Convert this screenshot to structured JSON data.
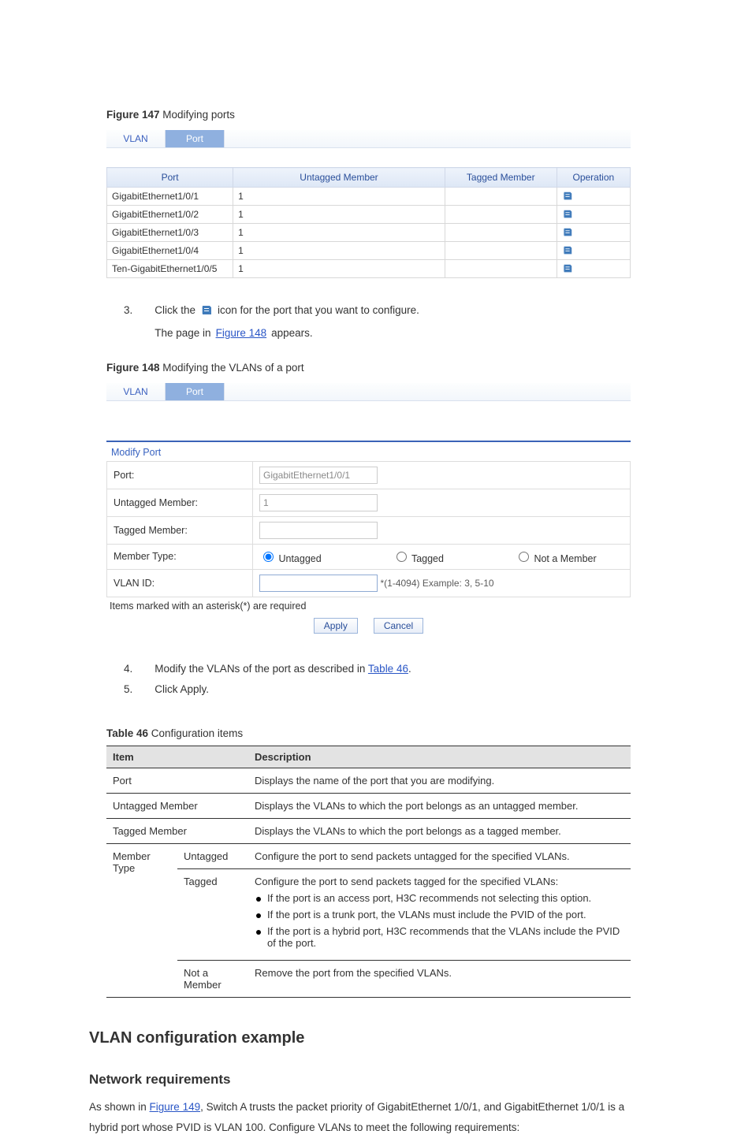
{
  "figure1": {
    "caption_label": "Figure 147",
    "caption_text": "Modifying ports",
    "tabs": {
      "vlan": "VLAN",
      "port": "Port"
    },
    "table": {
      "headers": {
        "port": "Port",
        "untagged": "Untagged Member",
        "tagged": "Tagged Member",
        "operation": "Operation"
      },
      "rows": [
        {
          "port": "GigabitEthernet1/0/1",
          "untagged": "1",
          "tagged": ""
        },
        {
          "port": "GigabitEthernet1/0/2",
          "untagged": "1",
          "tagged": ""
        },
        {
          "port": "GigabitEthernet1/0/3",
          "untagged": "1",
          "tagged": ""
        },
        {
          "port": "GigabitEthernet1/0/4",
          "untagged": "1",
          "tagged": ""
        },
        {
          "port": "Ten-GigabitEthernet1/0/5",
          "untagged": "1",
          "tagged": ""
        }
      ]
    }
  },
  "instruction": {
    "step_num": "3.",
    "text_before_icon": "Click the",
    "text_after_icon": "icon for the port that you want to configure.",
    "link_prefix": "The page in ",
    "link_text": "Figure 148",
    "link_suffix": " appears."
  },
  "figure2": {
    "caption_label": "Figure 148",
    "caption_text": "Modifying the VLANs of a port",
    "tabs": {
      "vlan": "VLAN",
      "port": "Port"
    },
    "panel_title": "Modify Port",
    "fields": {
      "port_label": "Port:",
      "port_value": "GigabitEthernet1/0/1",
      "untagged_label": "Untagged Member:",
      "untagged_value": "1",
      "tagged_label": "Tagged Member:",
      "tagged_value": "",
      "member_type_label": "Member Type:",
      "radio_untagged": "Untagged",
      "radio_tagged": "Tagged",
      "radio_not_member": "Not a Member",
      "vlan_id_label": "VLAN ID:",
      "vlan_id_value": "",
      "vlan_id_hint": "*(1-4094) Example: 3, 5-10"
    },
    "required_note": "Items marked with an asterisk(*) are required",
    "buttons": {
      "apply": "Apply",
      "cancel": "Cancel"
    }
  },
  "step4": {
    "num": "4.",
    "text_before_link": "Modify the VLANs of the port as described in ",
    "link_text": "Table 46",
    "text_after_link": "."
  },
  "step5": {
    "num": "5.",
    "text": "Click Apply."
  },
  "desc": {
    "caption_label": "Table 46",
    "caption_text": "Configuration items",
    "headers": {
      "item": "Item",
      "desc": "Description"
    },
    "rows": {
      "port": {
        "item": "Port",
        "desc": "Displays the name of the port that you are modifying."
      },
      "untagged_member": {
        "item": "Untagged Member",
        "desc": "Displays the VLANs to which the port belongs as an untagged member."
      },
      "tagged_member": {
        "item": "Tagged Member",
        "desc": "Displays the VLANs to which the port belongs as a tagged member."
      },
      "member_type": {
        "item": "Member Type",
        "sub_untagged": "Untagged",
        "sub_untagged_desc": "Configure the port to send packets untagged for the specified VLANs.",
        "sub_tagged": "Tagged",
        "sub_tagged_desc_intro": "Configure the port to send packets tagged for the specified VLANs:",
        "bullets": [
          "If the port is an access port, H3C recommends not selecting this option.",
          "If the port is a trunk port, the VLANs must include the PVID of the port.",
          "If the port is a hybrid port, H3C recommends that the VLANs include the PVID of the port."
        ],
        "sub_not_member": "Not a Member",
        "sub_not_member_desc": "Remove the port from the specified VLANs."
      }
    }
  },
  "final": {
    "heading1": "VLAN configuration example",
    "heading2": "Network requirements",
    "para_before_link": "As shown in ",
    "link": "Figure 149",
    "para_after_link": ", Switch A trusts the packet priority of GigabitEthernet 1/0/1, and GigabitEthernet 1/0/1 is a hybrid port whose PVID is VLAN 100. Configure VLANs to meet the following requirements:"
  }
}
